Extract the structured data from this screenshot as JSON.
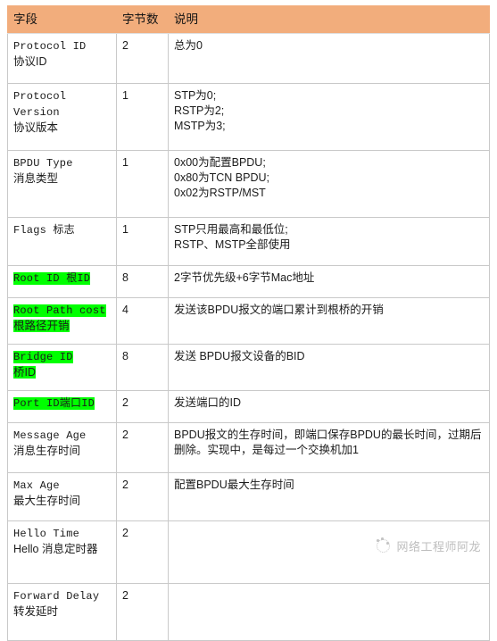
{
  "table": {
    "headers": [
      "字段",
      "字节数",
      "说明"
    ],
    "header_bg": "#F2AD7C",
    "highlight_color": "#00FF00",
    "rows": [
      {
        "key": "protocol-id",
        "field_en": "Protocol ID",
        "field_cn": "协议ID",
        "highlighted": false,
        "bytes": "2",
        "desc": [
          "总为0"
        ]
      },
      {
        "key": "protocol-version",
        "field_en": "Protocol Version",
        "field_cn": "协议版本",
        "highlighted": false,
        "bytes": "1",
        "desc": [
          "STP为0;",
          "RSTP为2;",
          "MSTP为3;"
        ]
      },
      {
        "key": "bpdu-type",
        "field_en": "BPDU Type",
        "field_cn": "消息类型",
        "highlighted": false,
        "bytes": "1",
        "desc": [
          "0x00为配置BPDU;",
          "0x80为TCN BPDU;",
          "0x02为RSTP/MST"
        ]
      },
      {
        "key": "flags",
        "field_en": "Flags 标志",
        "field_cn": "",
        "highlighted": false,
        "bytes": "1",
        "desc": [
          "STP只用最高和最低位;",
          "RSTP、MSTP全部使用"
        ]
      },
      {
        "key": "root-id",
        "field_en": "Root ID 根ID",
        "field_cn": "",
        "highlighted": true,
        "bytes": "8",
        "desc": [
          "2字节优先级+6字节Mac地址"
        ]
      },
      {
        "key": "root-path-cost",
        "field_en": "Root Path cost",
        "field_cn": "根路径开销",
        "highlighted": true,
        "bytes": "4",
        "desc": [
          "发送该BPDU报文的端口累计到根桥的开销"
        ]
      },
      {
        "key": "bridge-id",
        "field_en": "Bridge ID",
        "field_cn": "桥ID",
        "highlighted": true,
        "bytes": "8",
        "desc": [
          "发送 BPDU报文设备的BID"
        ]
      },
      {
        "key": "port-id",
        "field_en": "Port ID端口ID",
        "field_cn": "",
        "highlighted": true,
        "bytes": "2",
        "desc": [
          "发送端口的ID"
        ]
      },
      {
        "key": "message-age",
        "field_en": "Message Age",
        "field_cn": "消息生存时间",
        "highlighted": false,
        "bytes": "2",
        "desc": [
          "BPDU报文的生存时间，即端口保存BPDU的最长时间，过期后删除。实现中，是每过一个交换机加1"
        ]
      },
      {
        "key": "max-age",
        "field_en": "Max Age",
        "field_cn": "最大生存时间",
        "highlighted": false,
        "bytes": "2",
        "desc": [
          "配置BPDU最大生存时间"
        ]
      },
      {
        "key": "hello-time",
        "field_en": "Hello Time",
        "field_cn": "Hello 消息定时器",
        "highlighted": false,
        "bytes": "2",
        "desc": [
          ""
        ]
      },
      {
        "key": "forward-delay",
        "field_en": "Forward Delay",
        "field_cn": "转发延时",
        "highlighted": false,
        "bytes": "2",
        "desc": [
          ""
        ]
      }
    ]
  },
  "watermark": {
    "text": "网络工程师阿龙",
    "icon": "camera-dots-icon"
  }
}
